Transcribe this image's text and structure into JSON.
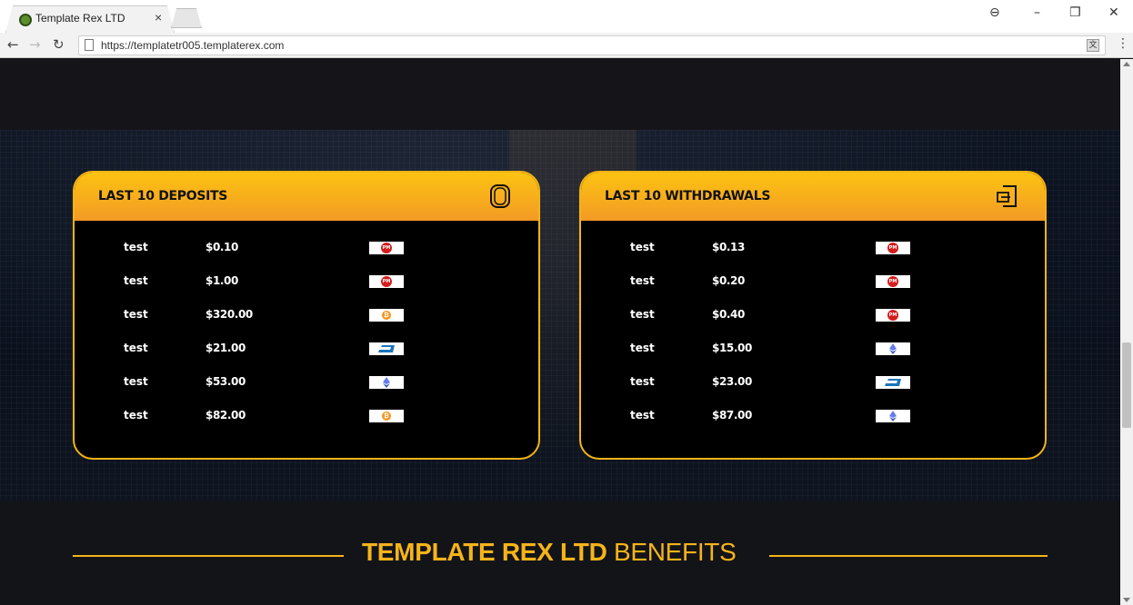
{
  "browser": {
    "tab_title": "Template Rex LTD",
    "tab_close": "×",
    "url": "https://templatetr005.templaterex.com",
    "controls": {
      "minimize": "–",
      "restore": "❐",
      "close": "✕",
      "account": "⊖"
    }
  },
  "deposits": {
    "title": "LAST 10 DEPOSITS",
    "icon": "coin-icon",
    "rows": [
      {
        "user": "test",
        "amount": "$0.10",
        "method": "perfect-money"
      },
      {
        "user": "test",
        "amount": "$1.00",
        "method": "perfect-money"
      },
      {
        "user": "test",
        "amount": "$320.00",
        "method": "bitcoin"
      },
      {
        "user": "test",
        "amount": "$21.00",
        "method": "dash"
      },
      {
        "user": "test",
        "amount": "$53.00",
        "method": "ethereum"
      },
      {
        "user": "test",
        "amount": "$82.00",
        "method": "bitcoin"
      }
    ]
  },
  "withdrawals": {
    "title": "LAST 10 WITHDRAWALS",
    "icon": "wallet-exit-icon",
    "rows": [
      {
        "user": "test",
        "amount": "$0.13",
        "method": "perfect-money"
      },
      {
        "user": "test",
        "amount": "$0.20",
        "method": "perfect-money"
      },
      {
        "user": "test",
        "amount": "$0.40",
        "method": "perfect-money"
      },
      {
        "user": "test",
        "amount": "$15.00",
        "method": "ethereum"
      },
      {
        "user": "test",
        "amount": "$23.00",
        "method": "dash"
      },
      {
        "user": "test",
        "amount": "$87.00",
        "method": "ethereum"
      }
    ]
  },
  "benefits": {
    "title_highlight": "TEMPLATE REX LTD",
    "title_rest": " BENEFITS"
  },
  "colors": {
    "accent": "#f4b416",
    "accent_dark": "#f39a25",
    "bg": "#131418"
  }
}
